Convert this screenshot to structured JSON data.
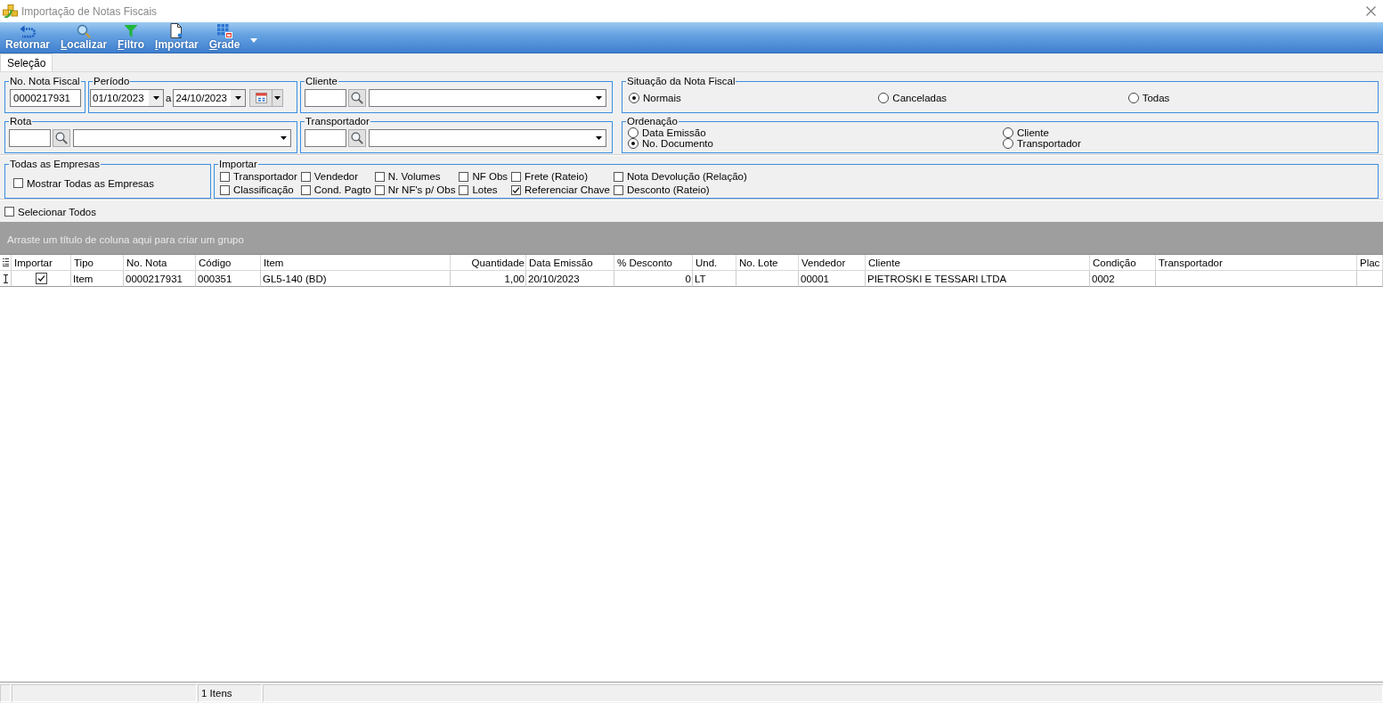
{
  "window": {
    "title": "Importação de Notas Fiscais"
  },
  "toolbar": {
    "buttons": [
      {
        "label": "Retornar",
        "kind": "back",
        "mnemonic": false
      },
      {
        "label": "Localizar",
        "kind": "find",
        "mnemonic": true
      },
      {
        "label": "Filtro",
        "kind": "filter",
        "mnemonic": true
      },
      {
        "label": "Importar",
        "kind": "import",
        "mnemonic": true
      },
      {
        "label": "Grade",
        "kind": "grid",
        "mnemonic": true
      }
    ]
  },
  "tabs": [
    {
      "label": "Seleção",
      "selected": true
    }
  ],
  "filters": {
    "nota_fiscal": {
      "legend": "No. Nota Fiscal",
      "value": "0000217931"
    },
    "periodo": {
      "legend": "Período",
      "from": "01/10/2023",
      "separator": "a",
      "to": "24/10/2023"
    },
    "cliente": {
      "legend": "Cliente"
    },
    "situacao": {
      "legend": "Situação da Nota Fiscal",
      "options": [
        {
          "label": "Normais",
          "selected": true
        },
        {
          "label": "Canceladas",
          "selected": false
        },
        {
          "label": "Todas",
          "selected": false
        }
      ]
    },
    "rota": {
      "legend": "Rota"
    },
    "transportador": {
      "legend": "Transportador"
    },
    "ordenacao": {
      "legend": "Ordenação",
      "options": [
        {
          "label": "Data Emissão",
          "selected": false
        },
        {
          "label": "Cliente",
          "selected": false
        },
        {
          "label": "No. Documento",
          "selected": true
        },
        {
          "label": "Transportador",
          "selected": false
        }
      ]
    },
    "empresas": {
      "legend": "Todas as Empresas",
      "option": {
        "label": "Mostrar Todas as Empresas",
        "checked": false
      }
    },
    "importar": {
      "legend": "Importar",
      "options": [
        {
          "label": "Transportador",
          "checked": false
        },
        {
          "label": "Classificação",
          "checked": false
        },
        {
          "label": "Vendedor",
          "checked": false
        },
        {
          "label": "Cond. Pagto",
          "checked": false
        },
        {
          "label": "N. Volumes",
          "checked": false
        },
        {
          "label": "Nr NF's p/ Obs",
          "checked": false
        },
        {
          "label": "NF Obs",
          "checked": false
        },
        {
          "label": "Lotes",
          "checked": false
        },
        {
          "label": "Frete (Rateio)",
          "checked": false
        },
        {
          "label": "Referenciar Chave",
          "checked": true
        },
        {
          "label": "Nota Devolução (Relação)",
          "checked": false
        },
        {
          "label": "Desconto (Rateio)",
          "checked": false
        }
      ]
    }
  },
  "select_all": {
    "label": "Selecionar Todos",
    "checked": false
  },
  "group_panel": {
    "hint": "Arraste um título de coluna aqui para criar um grupo"
  },
  "table": {
    "columns": [
      {
        "label": "Importar",
        "kind": "check",
        "header_right": false
      },
      {
        "label": "Tipo",
        "kind": "text",
        "header_right": false
      },
      {
        "label": "No. Nota",
        "kind": "text",
        "header_right": false
      },
      {
        "label": "Código",
        "kind": "text",
        "header_right": false
      },
      {
        "label": "Item",
        "kind": "text",
        "header_right": false
      },
      {
        "label": "Quantidade",
        "kind": "number",
        "header_right": true
      },
      {
        "label": "Data Emissão",
        "kind": "text",
        "header_right": false
      },
      {
        "label": "% Desconto",
        "kind": "number",
        "header_right": false
      },
      {
        "label": "Und.",
        "kind": "text",
        "header_right": false
      },
      {
        "label": "No. Lote",
        "kind": "text",
        "header_right": false
      },
      {
        "label": "Vendedor",
        "kind": "text",
        "header_right": false
      },
      {
        "label": "Cliente",
        "kind": "text",
        "header_right": false
      },
      {
        "label": "Condição",
        "kind": "text",
        "header_right": false
      },
      {
        "label": "Transportador",
        "kind": "text",
        "header_right": false
      },
      {
        "label": "Plac",
        "kind": "text",
        "header_right": false
      }
    ],
    "rows": [
      {
        "current": true,
        "cells": [
          {
            "checked": true
          },
          {
            "text": "Item"
          },
          {
            "text": "0000217931"
          },
          {
            "text": "000351"
          },
          {
            "text": "GL5-140 (BD)"
          },
          {
            "text": "1,00"
          },
          {
            "text": "20/10/2023"
          },
          {
            "text": "0"
          },
          {
            "text": "LT"
          },
          {},
          {
            "text": "00001"
          },
          {
            "text": "PIETROSKI E TESSARI LTDA"
          },
          {
            "text": "0002"
          },
          {},
          {}
        ]
      }
    ]
  },
  "status_bar": {
    "count": "1 Itens"
  }
}
